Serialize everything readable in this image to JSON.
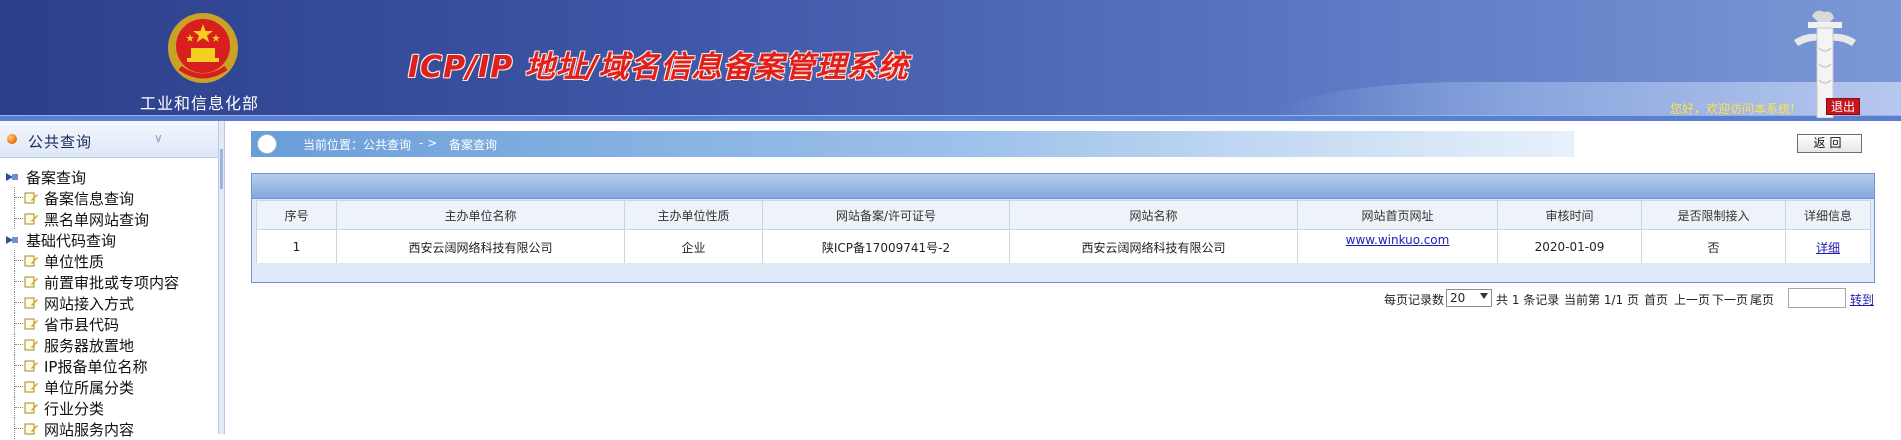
{
  "header": {
    "ministry_name": "工业和信息化部",
    "system_title": "ICP/IP 地址/域名信息备案管理系统",
    "welcome_text": "您好，欢迎访问本系统!",
    "logout_label": "退出"
  },
  "sidebar": {
    "title": "公共查询",
    "groups": [
      {
        "label": "备案查询",
        "items": [
          "备案信息查询",
          "黑名单网站查询"
        ]
      },
      {
        "label": "基础代码查询",
        "items": [
          "单位性质",
          "前置审批或专项内容",
          "网站接入方式",
          "省市县代码",
          "服务器放置地",
          "IP报备单位名称",
          "单位所属分类",
          "行业分类",
          "网站服务内容"
        ]
      }
    ]
  },
  "breadcrumb": {
    "label": "当前位置：公共查询",
    "separator": "- >",
    "current": "备案查询"
  },
  "back_button_label": "返回",
  "table": {
    "headers": [
      "序号",
      "主办单位名称",
      "主办单位性质",
      "网站备案/许可证号",
      "网站名称",
      "网站首页网址",
      "审核时间",
      "是否限制接入",
      "详细信息"
    ],
    "rows": [
      [
        "1",
        "西安云阔网络科技有限公司",
        "企业",
        "陕ICP备17009741号-2",
        "西安云阔网络科技有限公司",
        "www.winkuo.com",
        "2020-01-09",
        "否",
        "详细"
      ]
    ]
  },
  "pager": {
    "per_page_label": "每页记录数",
    "per_page_value": "20",
    "total_text": "共 1 条记录",
    "current_text": "当前第 1/1 页",
    "first_label": "首页",
    "prev_label": "上一页",
    "next_label": "下一页",
    "last_label": "尾页",
    "goto_label": "转到"
  },
  "colors": {
    "header_blue": "#2c3f8a",
    "title_red": "#e0201c",
    "link_blue": "#1f1bb0",
    "logout_red": "#c8141c",
    "welcome_yellow": "#ffe347"
  }
}
